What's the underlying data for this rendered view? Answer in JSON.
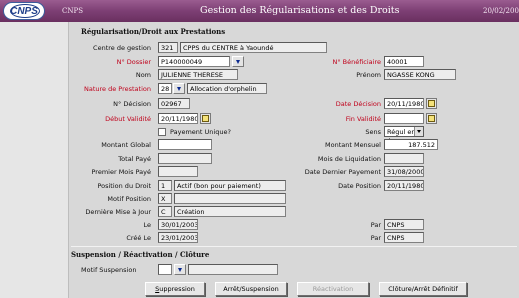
{
  "titlebar": {
    "logo": "CNPS",
    "app": "CNPS",
    "title": "Gestion des Régularisations et des Droits",
    "date": "20/02/200"
  },
  "section1": {
    "title": "Régularisation/Droit aux Prestations"
  },
  "form": {
    "centre_label": "Centre de gestion",
    "centre_code": "321",
    "centre_name": "CPPS du CENTRE à Yaoundé",
    "dossier_label": "N° Dossier",
    "dossier_value": "P140000049",
    "beneficiaire_label": "N° Bénéficiaire",
    "beneficiaire_value": "40001",
    "nom_label": "Nom",
    "nom_value": "JULIENNE THERESE",
    "prenom_label": "Prénom",
    "prenom_value": "NGASSE KONG",
    "nature_label": "Nature de Prestation",
    "nature_code": "28",
    "nature_value": "Allocation d'orphelin",
    "decision_label": "N° Décision",
    "decision_value": "02967",
    "date_decision_label": "Date Décision",
    "date_decision_value": "20/11/1980",
    "debut_label": "Début Validité",
    "debut_value": "20/11/1980",
    "fin_label": "Fin Validité",
    "fin_value": "",
    "payement_unique_label": "Payement Unique?",
    "sens_label": "Sens",
    "sens_value": "Régul en +",
    "montant_global_label": "Montant Global",
    "montant_global_value": "",
    "montant_mensuel_label": "Montant Mensuel",
    "montant_mensuel_value": "187.512",
    "total_paye_label": "Total Payé",
    "total_paye_value": "",
    "mois_liquidation_label": "Mois de Liquidation",
    "mois_liquidation_value": "",
    "premier_mois_label": "Premier Mois Payé",
    "premier_mois_value": "",
    "date_dernier_label": "Date Dernier Payement",
    "date_dernier_value": "31/08/2000",
    "position_label": "Position du Droit",
    "position_code": "1",
    "position_value": "Actif (bon pour paiement)",
    "date_position_label": "Date Position",
    "date_position_value": "20/11/1980",
    "motif_label": "Motif Position",
    "motif_value": "X",
    "maj_label": "Dernière Mise à Jour",
    "maj_code": "C",
    "maj_value": "Création",
    "le_label": "Le",
    "le_value": "30/01/2003",
    "par1_label": "Par",
    "par1_value": "CNPS",
    "cree_label": "Créé Le",
    "cree_value": "23/01/2003",
    "par2_label": "Par",
    "par2_value": "CNPS"
  },
  "section2": {
    "title": "Suspension / Réactivation / Clôture",
    "motif_label": "Motif Suspension",
    "motif_value": ""
  },
  "buttons": {
    "suspension_first": "S",
    "suspension_rest": "uppression",
    "arret": "Arrêt/Suspension",
    "reactivation": "Réactivation",
    "cloture": "Clôture/Arrêt Définitif"
  },
  "colors": {
    "titlebar": "#7d3f74",
    "required_label": "#c0001a",
    "panel": "#d8d8d8"
  }
}
